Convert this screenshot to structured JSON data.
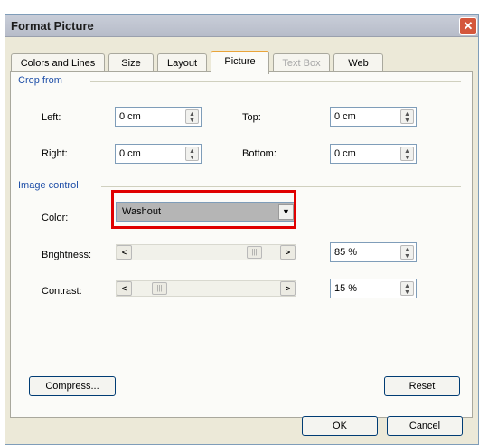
{
  "window": {
    "title": "Format Picture",
    "close_glyph": "✕"
  },
  "tabs": [
    {
      "label": "Colors and Lines",
      "state": "normal"
    },
    {
      "label": "Size",
      "state": "normal"
    },
    {
      "label": "Layout",
      "state": "normal"
    },
    {
      "label": "Picture",
      "state": "active"
    },
    {
      "label": "Text Box",
      "state": "disabled"
    },
    {
      "label": "Web",
      "state": "normal"
    }
  ],
  "crop": {
    "heading": "Crop from",
    "left": {
      "label": "Left:",
      "value": "0 cm"
    },
    "right": {
      "label": "Right:",
      "value": "0 cm"
    },
    "top": {
      "label": "Top:",
      "value": "0 cm"
    },
    "bottom": {
      "label": "Bottom:",
      "value": "0 cm"
    }
  },
  "image_control": {
    "heading": "Image control",
    "color": {
      "label": "Color:",
      "value": "Washout",
      "highlight_color": "#e00000"
    },
    "brightness": {
      "label": "Brightness:",
      "value": "85 %",
      "level": 0.85
    },
    "contrast": {
      "label": "Contrast:",
      "value": "15 %",
      "level": 0.15
    }
  },
  "buttons": {
    "compress": "Compress...",
    "reset": "Reset",
    "ok": "OK",
    "cancel": "Cancel"
  },
  "icons": {
    "spin": "spin-arrows-icon",
    "dropdown": "chevron-down-icon",
    "slider_left": "arrow-left-icon",
    "slider_right": "arrow-right-icon"
  }
}
